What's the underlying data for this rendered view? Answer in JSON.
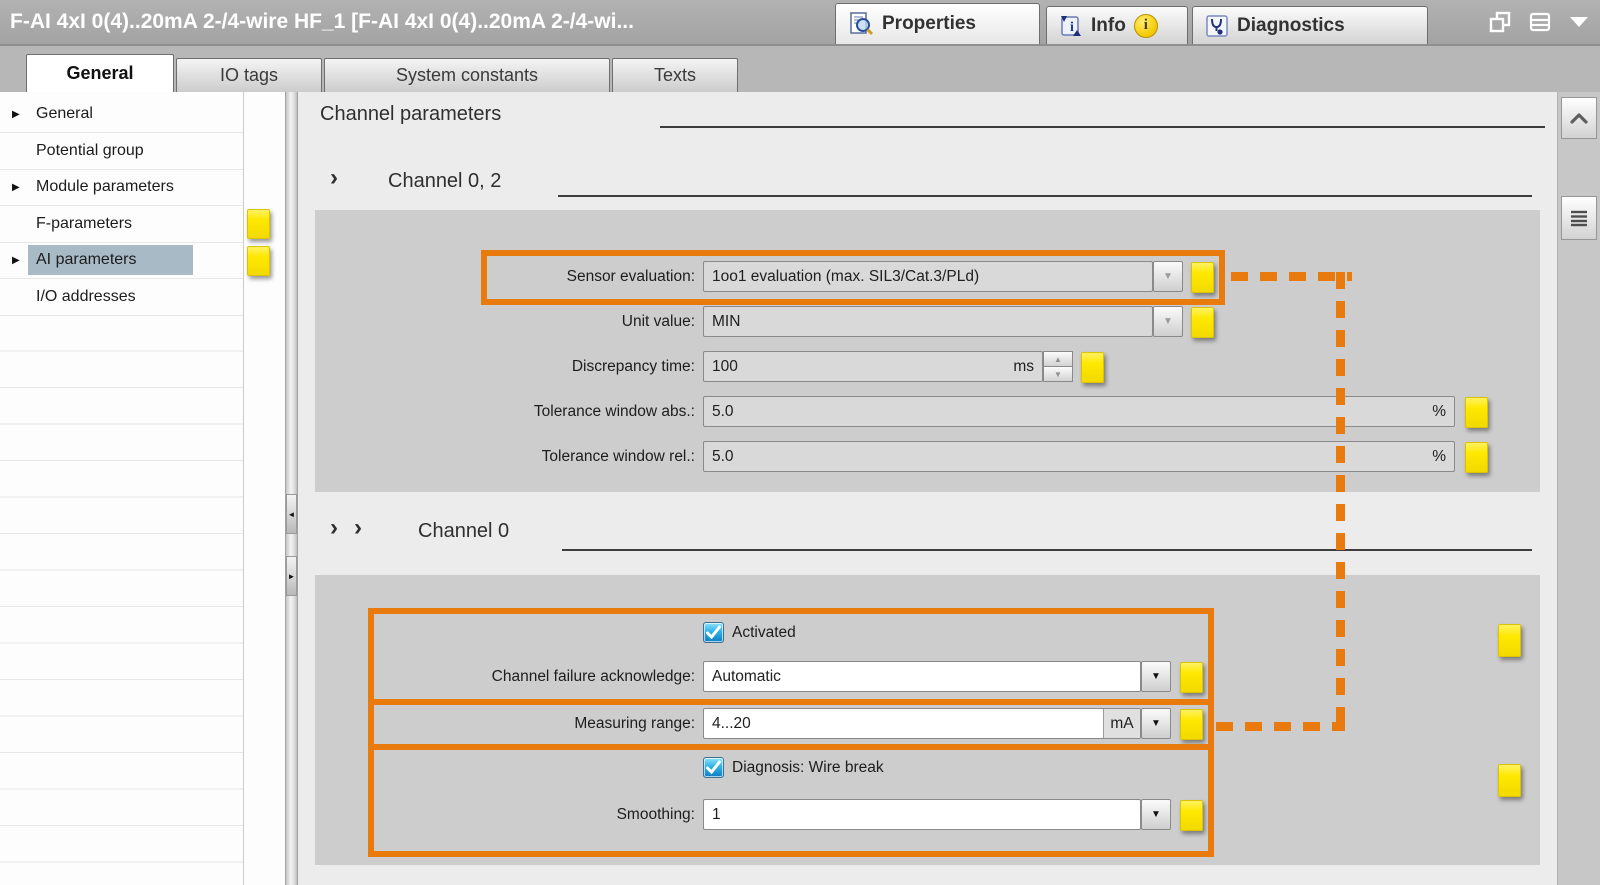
{
  "titlebar": {
    "title": "F-AI 4xI 0(4)..20mA 2-/4-wire HF_1 [F-AI 4xI 0(4)..20mA 2-/4-wi...",
    "tabs": {
      "properties": "Properties",
      "info": "Info",
      "diagnostics": "Diagnostics"
    },
    "info_badge": "i"
  },
  "subtabs": {
    "general": "General",
    "io_tags": "IO tags",
    "system_constants": "System constants",
    "texts": "Texts"
  },
  "nav": {
    "general": "General",
    "potential_group": "Potential group",
    "module_parameters": "Module parameters",
    "f_parameters": "F-parameters",
    "ai_parameters": "AI parameters",
    "io_addresses": "I/O addresses"
  },
  "page": {
    "heading": "Channel parameters"
  },
  "section1": {
    "heading": "Channel 0, 2",
    "sensor": {
      "label": "Sensor evaluation:",
      "value": "1oo1 evaluation (max. SIL3/Cat.3/PLd)"
    },
    "unit_value": {
      "label": "Unit value:",
      "value": "MIN"
    },
    "discrepancy": {
      "label": "Discrepancy time:",
      "value": "100",
      "unit": "ms"
    },
    "tol_abs": {
      "label": "Tolerance window abs.:",
      "value": "5.0",
      "unit": "%"
    },
    "tol_rel": {
      "label": "Tolerance window rel.:",
      "value": "5.0",
      "unit": "%"
    }
  },
  "section2": {
    "heading": "Channel 0",
    "activated": {
      "label": "Activated",
      "checked": true
    },
    "failure_ack": {
      "label": "Channel failure acknowledge:",
      "value": "Automatic"
    },
    "range": {
      "label": "Measuring range:",
      "value": "4...20",
      "unit": "mA"
    },
    "diagnosis": {
      "label": "Diagnosis: Wire break",
      "checked": true
    },
    "smoothing": {
      "label": "Smoothing:",
      "value": "1"
    }
  },
  "icons": {
    "expand_arrow": "▶",
    "dropdown_arrow": "▼",
    "spin_up": "▲",
    "spin_down": "▼",
    "chevron": "›",
    "collapse_left": "◄",
    "collapse_right": "►"
  },
  "colors": {
    "highlight_orange": "#e87a0e",
    "change_marker_yellow": "#ffe800",
    "checkbox_blue": "#1e88c7",
    "selected_nav": "#a9bac7",
    "panel_gray": "#cdcdcd"
  }
}
